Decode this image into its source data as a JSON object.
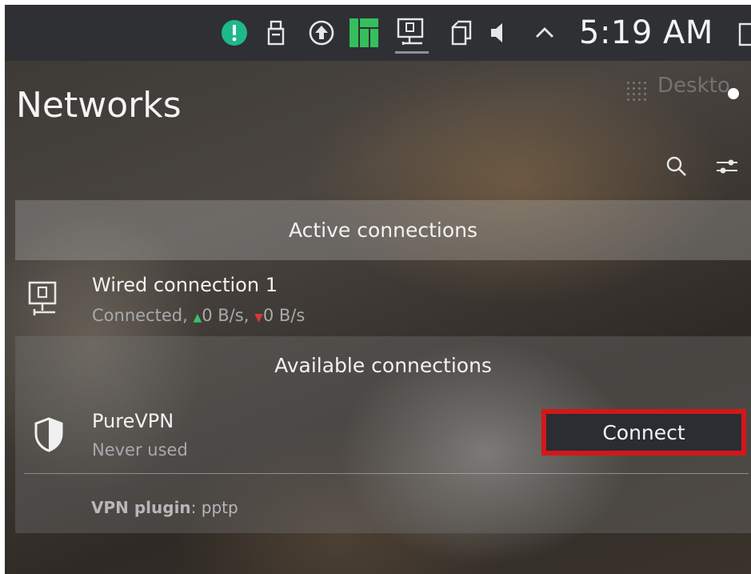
{
  "taskbar": {
    "clock": "5:19 AM",
    "icons": [
      "update-notifier-icon",
      "usb-drive-icon",
      "upload-icon",
      "manjaro-logo-icon",
      "network-wired-icon",
      "clipboard-icon",
      "volume-icon",
      "expand-tray-icon",
      "desktop-edge-icon"
    ]
  },
  "desktop_button": {
    "label": "Deskto"
  },
  "panel": {
    "title": "Networks",
    "search_icon": "search-icon",
    "config_icon": "configure-icon"
  },
  "active": {
    "header": "Active connections",
    "items": [
      {
        "name": "Wired connection 1",
        "status_prefix": "Connected,",
        "download": "0 B/s,",
        "upload": "0 B/s",
        "icon": "network-wired-icon"
      }
    ]
  },
  "available": {
    "header": "Available connections",
    "items": [
      {
        "name": "PureVPN",
        "status": "Never used",
        "icon": "vpn-shield-icon",
        "connect_label": "Connect",
        "plugin_label": "VPN plugin",
        "plugin_value": ": pptp"
      }
    ]
  },
  "colors": {
    "taskbar": "#2e3033",
    "update_green": "#1fb88a",
    "manjaro_green": "#35bf5c",
    "highlight_red": "#d3171a",
    "download_arrow": "#3bbf6a",
    "upload_arrow": "#d23a3a",
    "button_bg": "#2a2d31"
  }
}
